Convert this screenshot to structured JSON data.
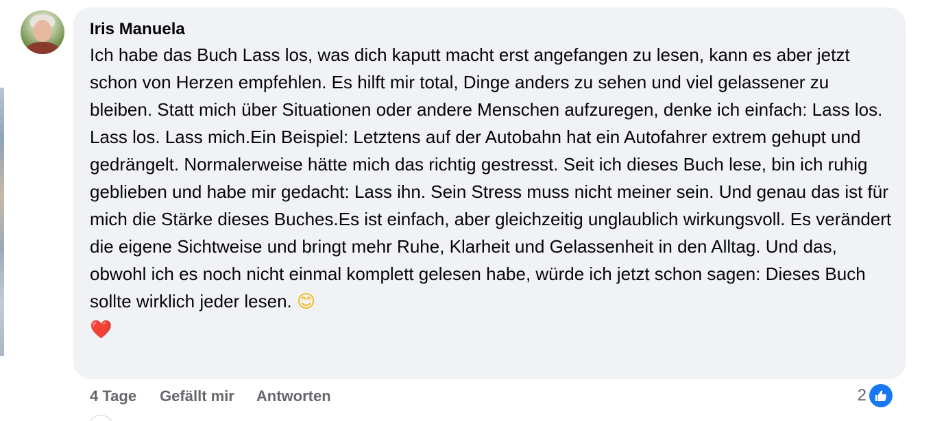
{
  "comment": {
    "author": "Iris Manuela",
    "text": "Ich habe das Buch Lass los, was dich kaputt macht erst angefangen zu lesen, kann es aber jetzt schon von Herzen empfehlen. Es hilft mir total, Dinge anders zu sehen und viel gelassener zu bleiben. Statt mich über Situationen oder andere Menschen aufzuregen, denke ich einfach: Lass los. Lass los. Lass mich.Ein Beispiel: Letztens auf der Autobahn hat ein Autofahrer extrem gehupt und gedrängelt. Normalerweise hätte mich das richtig gestresst. Seit ich dieses Buch lese, bin ich ruhig geblieben und habe mir gedacht: Lass ihn. Sein Stress muss nicht meiner sein. Und genau das ist für mich die Stärke dieses Buches.Es ist einfach, aber gleichzeitig unglaublich wirkungsvoll. Es verändert die eigene Sichtweise und bringt mehr Ruhe, Klarheit und Gelassenheit in den Alltag. Und das, obwohl ich es noch nicht einmal komplett gelesen habe, würde ich jetzt schon sagen: Dieses Buch sollte wirklich jeder lesen.",
    "emoji_smile": "😊",
    "emoji_heart": "❤️",
    "timestamp": "4 Tage",
    "like_label": "Gefällt mir",
    "reply_label": "Antworten",
    "reaction_count": "2",
    "reaction_icon": "thumbs-up-icon"
  },
  "colors": {
    "bubble_background": "#f0f2f5",
    "text": "#050505",
    "secondary_text": "#65676b",
    "like_blue": "#1877f2"
  }
}
